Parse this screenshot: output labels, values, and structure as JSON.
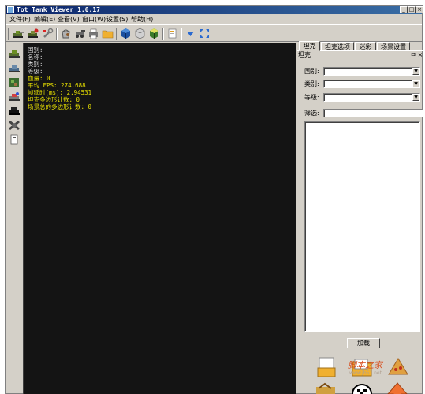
{
  "window": {
    "title": "Tot Tank Viewer 1.0.17",
    "controls": {
      "minimize": "_",
      "maximize": "□",
      "close": "×"
    }
  },
  "menu": [
    {
      "label": "文件(F)"
    },
    {
      "label": "编辑(E)"
    },
    {
      "label": "查看(V)"
    },
    {
      "label": "窗口(W)"
    },
    {
      "label": "设置(S)"
    },
    {
      "label": "帮助(H)"
    }
  ],
  "toolbar": {
    "icons": [
      "tank-icon",
      "tank-red-icon",
      "wrench-icon",
      "bucket-icon",
      "cannon-icon",
      "printer-icon",
      "folder-icon",
      "cube-blue-icon",
      "cube-wire-icon",
      "cube-green-icon",
      "page-icon",
      "arrow-down-icon",
      "fullscreen-icon"
    ]
  },
  "left_tools": {
    "icons": [
      "tank-green-icon",
      "tank-blue-icon",
      "map-icon",
      "tank-color-icon",
      "tank-black-icon",
      "tank-gray-icon",
      "small-page-icon"
    ]
  },
  "info": {
    "country": "国别:",
    "name": "名称:",
    "class": "类别:",
    "tier": "等级:",
    "hp": "血量: 0",
    "fps": "平均 FPS: 274.688",
    "frame_time": "帧延时(ms): 2.94531",
    "tank_poly": "坦克多边形计数: 0",
    "scene_poly": "场景总的多边形计数: 0"
  },
  "right_panel": {
    "tabs": [
      {
        "label": "坦克",
        "active": true
      },
      {
        "label": "坦克选项",
        "active": false
      },
      {
        "label": "迷彩",
        "active": false
      },
      {
        "label": "场景设置",
        "active": false
      }
    ],
    "header": "坦克",
    "pin": "ㅁ",
    "close": "×",
    "fields": {
      "country_label": "国别:",
      "class_label": "类别:",
      "tier_label": "等级:",
      "filter_label": "筛选:",
      "country_value": "",
      "class_value": "",
      "tier_value": "",
      "filter_value": ""
    },
    "load_button": "加载",
    "watermark": "脚本之家",
    "watermark_sub": "www.jb51.net"
  },
  "colors": {
    "info_text": "#e8e000",
    "info_text_dim": "#d8d8d8",
    "viewport_bg": "#141414",
    "window_bg": "#d4d0c8"
  }
}
